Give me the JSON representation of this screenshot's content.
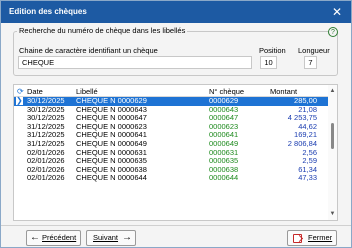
{
  "window": {
    "title": "Edition des chèques",
    "close_label": "✕"
  },
  "search": {
    "group_label": "Recherche du numéro de chèque dans les libellés",
    "help_icon": "?",
    "string_label": "Chaine de caractère identifiant un chèque",
    "string_value": "CHEQUE",
    "position_label": "Position",
    "position_value": "10",
    "length_label": "Longueur",
    "length_value": "7"
  },
  "grid": {
    "columns": {
      "date": "Date",
      "libelle": "Libellé",
      "cheque": "N° chèque",
      "montant": "Montant"
    },
    "rows": [
      {
        "date": "30/12/2025",
        "libelle": "CHEQUE N 0000629",
        "cheque": "0000629",
        "montant": "285,00",
        "selected": true
      },
      {
        "date": "30/12/2025",
        "libelle": "CHEQUE N 0000643",
        "cheque": "0000643",
        "montant": "21,08"
      },
      {
        "date": "30/12/2025",
        "libelle": "CHEQUE N 0000647",
        "cheque": "0000647",
        "montant": "4 253,75"
      },
      {
        "date": "31/12/2025",
        "libelle": "CHEQUE N 0000623",
        "cheque": "0000623",
        "montant": "44,62"
      },
      {
        "date": "31/12/2025",
        "libelle": "CHEQUE N 0000641",
        "cheque": "0000641",
        "montant": "169,21"
      },
      {
        "date": "31/12/2025",
        "libelle": "CHEQUE N 0000649",
        "cheque": "0000649",
        "montant": "2 806,84"
      },
      {
        "date": "02/01/2026",
        "libelle": "CHEQUE N 0000631",
        "cheque": "0000631",
        "montant": "2,56"
      },
      {
        "date": "02/01/2026",
        "libelle": "CHEQUE N 0000635",
        "cheque": "0000635",
        "montant": "2,59"
      },
      {
        "date": "02/01/2026",
        "libelle": "CHEQUE N 0000638",
        "cheque": "0000638",
        "montant": "61,34"
      },
      {
        "date": "02/01/2026",
        "libelle": "CHEQUE N 0000644",
        "cheque": "0000644",
        "montant": "47,33"
      }
    ]
  },
  "buttons": {
    "previous": "Précédent",
    "next": "Suivant",
    "close": "Fermer"
  },
  "icons": {
    "previous": "arrow-left-icon",
    "next": "arrow-right-icon",
    "close": "exit-icon",
    "row_pointer": "row-pointer-icon"
  },
  "colors": {
    "titlebar": "#1d5aa3",
    "selection": "#1e73d4",
    "cheque_number": "#1d8a1d",
    "amount": "#1a3cb0"
  }
}
